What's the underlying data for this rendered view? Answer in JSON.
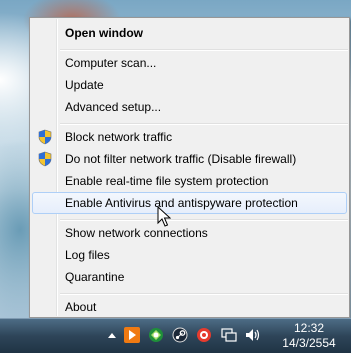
{
  "menu": {
    "items": [
      {
        "label": "Open window",
        "bold": true
      },
      {
        "label": "Computer scan..."
      },
      {
        "label": "Update"
      },
      {
        "label": "Advanced setup..."
      },
      {
        "label": "Block network traffic",
        "icon": "uac-shield-icon"
      },
      {
        "label": "Do not filter network traffic (Disable firewall)",
        "icon": "uac-shield-icon"
      },
      {
        "label": "Enable real-time file system protection"
      },
      {
        "label": "Enable Antivirus and antispyware protection",
        "highlighted": true
      },
      {
        "label": "Show network connections"
      },
      {
        "label": "Log files"
      },
      {
        "label": "Quarantine"
      },
      {
        "label": "About"
      }
    ]
  },
  "taskbar": {
    "clock_time": "12:32",
    "clock_date": "14/3/2554",
    "tray_icons": [
      "show-hidden-icons-arrow",
      "media-player-icon",
      "eset-tray-icon",
      "steam-icon",
      "antivirus-red-icon",
      "network-icon",
      "volume-icon"
    ]
  },
  "colors": {
    "menu_bg": "#f0f0f0",
    "highlight_border": "#aecff7",
    "taskbar": "#2e4559"
  }
}
